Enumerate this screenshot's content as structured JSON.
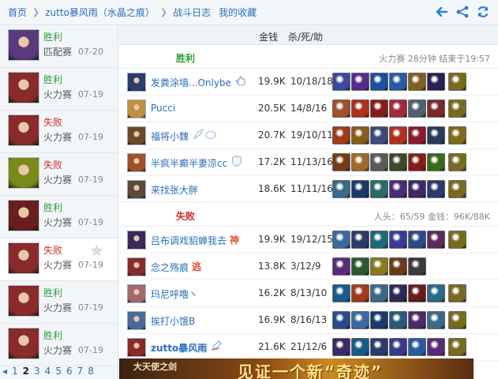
{
  "breadcrumb": {
    "home": "首页",
    "player": "zutto暴风雨（水晶之痕）",
    "battle_log": "战斗日志",
    "favorites": "我的收藏"
  },
  "colors": {
    "win": "#2f9d3c",
    "lose": "#d0302b",
    "link": "#2a6ebb"
  },
  "sidebar": {
    "matches": [
      {
        "result": "胜利",
        "mode": "匹配赛",
        "date": "07-20",
        "outcome": "win",
        "champ_color": "#5a3a7e"
      },
      {
        "result": "胜利",
        "mode": "火力赛",
        "date": "07-19",
        "outcome": "win",
        "champ_color": "#8a2b2b"
      },
      {
        "result": "失败",
        "mode": "火力赛",
        "date": "07-19",
        "outcome": "lose",
        "champ_color": "#8a2b2b"
      },
      {
        "result": "失败",
        "mode": "火力赛",
        "date": "07-19",
        "outcome": "lose",
        "champ_color": "#7a8a1a"
      },
      {
        "result": "胜利",
        "mode": "火力赛",
        "date": "07-19",
        "outcome": "win",
        "champ_color": "#6a1f1f"
      },
      {
        "result": "失败",
        "mode": "火力赛",
        "date": "07-19",
        "outcome": "lose",
        "champ_color": "#8a2b2b",
        "selected": true
      },
      {
        "result": "胜利",
        "mode": "火力赛",
        "date": "07-19",
        "outcome": "win",
        "champ_color": "#8a2b2b"
      },
      {
        "result": "胜利",
        "mode": "火力赛",
        "date": "07-19",
        "outcome": "win",
        "champ_color": "#8a2b2b"
      }
    ],
    "pager": {
      "prev": "◂",
      "pages": [
        "1",
        "2",
        "3",
        "4",
        "5",
        "6",
        "7",
        "8"
      ],
      "current": "2"
    }
  },
  "columns": {
    "gold": "金钱",
    "kda": "杀/死/助"
  },
  "teams": [
    {
      "result": "胜利",
      "outcome": "win",
      "info": "火力赛  28分钟  结束于19:57",
      "players": [
        {
          "name": "发粪涂墙...Onlybe",
          "tag": "hand",
          "gold": "19.9K",
          "kda": "10/18/18",
          "avatar": "#2a3f6e",
          "items": [
            "#3a4aa0",
            "#5a2a8a",
            "#1b4fa0",
            "#2a5aa0",
            "#806020",
            "#2b1f55",
            "#7a6a20"
          ]
        },
        {
          "name": "Pucci",
          "tag": "",
          "gold": "20.5K",
          "kda": "14/8/16",
          "avatar": "#c09040",
          "items": [
            "#a0502a",
            "#b0301c",
            "#8a1a1a",
            "#a02a3a",
            "#506070",
            "#7a2a2a",
            "#7a6a20"
          ]
        },
        {
          "name": "福将小魏",
          "tag": "feather",
          "gold": "20.7K",
          "kda": "19/10/11",
          "avatar": "#6a4a2a",
          "items": [
            "#a03a1a",
            "#8a5a1a",
            "#3a4a7a",
            "#b03020",
            "#8a1a2a",
            "#2a3a5a",
            "#806a1a"
          ]
        },
        {
          "name": "半疯半癫半妻凉cc",
          "tag": "shield",
          "gold": "17.2K",
          "kda": "11/13/16",
          "avatar": "#a0502a",
          "items": [
            "#7a3a1a",
            "#a06a2a",
            "#5a5a5a",
            "#3a4a2a",
            "#8a1a1a",
            "#3a6a1a",
            "#7a6a20"
          ]
        },
        {
          "name": "来找张大胖",
          "tag": "",
          "gold": "18.6K",
          "kda": "11/11/16",
          "avatar": "#5a4a3a",
          "items": [
            "#3a6a8a",
            "#1a3a6a",
            "#2a6a6a",
            "#4a2a7a",
            "#3a2a6a",
            "#2a3a6a",
            "#7a6a20"
          ]
        }
      ]
    },
    {
      "result": "失败",
      "outcome": "lose",
      "info": "人头：65/59  金钱：96K/88K",
      "players": [
        {
          "name": "吕布调戏貂蝉我去",
          "tag": "神",
          "gold": "19.9K",
          "kda": "19/12/15",
          "avatar": "#3a2a5a",
          "items": [
            "#3a6aa0",
            "#2a3a6a",
            "#1a6a7a",
            "#3a3a9a",
            "#2a4a8a",
            "#5a2a5a",
            "#7a6a20"
          ]
        },
        {
          "name": "念之殇痕",
          "tag": "逃",
          "gold": "13.8K",
          "kda": "3/12/9",
          "avatar": "#8a2a2a",
          "items": [
            "#5a2a7a",
            "#2a5a2a",
            "#8a7a1a",
            "#6a3a1a",
            "#3a3a3a"
          ]
        },
        {
          "name": "玛尼呼噜丶",
          "tag": "",
          "gold": "16.2K",
          "kda": "8/13/10",
          "avatar": "#a06a6a",
          "items": [
            "#1a5a8a",
            "#a03a1a",
            "#3a6a8a",
            "#2a2a5a",
            "#6a1a1a",
            "#2a6a8a",
            "#7a6a20"
          ]
        },
        {
          "name": "挨打小饿B",
          "tag": "",
          "gold": "16.9K",
          "kda": "8/16/13",
          "avatar": "#4a6a9a",
          "items": [
            "#2a4a8a",
            "#3a6aa0",
            "#1a3a6a",
            "#2a5a7a",
            "#4a2a6a",
            "#3a6a8a",
            "#7a6a20"
          ]
        },
        {
          "name": "zutto暴风雨",
          "tag": "pen",
          "gold": "21.6K",
          "kda": "21/12/6",
          "avatar": "#8a2a2a",
          "bold": true,
          "items": [
            "#3a2a6a",
            "#1a5a8a",
            "#2a3a6a",
            "#3a3a8a",
            "#2a5aa0",
            "#5a2a7a",
            "#7a6a20"
          ]
        }
      ]
    }
  ],
  "banner": {
    "logo": "大天使之剑",
    "slogan": "见证一个新“奇迹”"
  }
}
